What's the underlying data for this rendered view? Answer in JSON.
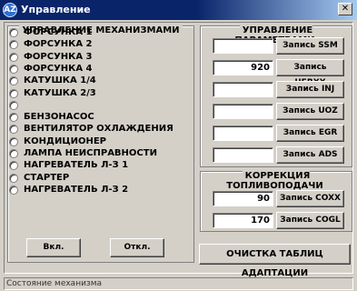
{
  "window": {
    "title": "Управление",
    "icon_text": "AZ",
    "close_symbol": "✕"
  },
  "mechanisms": {
    "title": "УПРАВЛЕНИЕ МЕХАНИЗМАМИ",
    "items": [
      "ФОРСУНКА 1",
      "ФОРСУНКА 2",
      "ФОРСУНКА 3",
      "ФОРСУНКА 4",
      "КАТУШКА 1/4",
      "КАТУШКА 2/3",
      "",
      "БЕНЗОНАСОС",
      "ВЕНТИЛЯТОР ОХЛАЖДЕНИЯ",
      "КОНДИЦИОНЕР",
      "ЛАМПА НЕИСПРАВНОСТИ",
      "НАГРЕВАТЕЛЬ Л-З 1",
      "СТАРТЕР",
      "НАГРЕВАТЕЛЬ Л-З 2"
    ],
    "on_button": "Вкл.",
    "off_button": "Откл."
  },
  "params": {
    "title": "УПРАВЛЕНИЕ ПАРАМЕТРАМИ",
    "rows": [
      {
        "value": "",
        "button": "Запись SSM"
      },
      {
        "value": "920",
        "button": "Запись UFRXX"
      },
      {
        "value": "",
        "button": "Запись INJ"
      },
      {
        "value": "",
        "button": "Запись UOZ"
      },
      {
        "value": "",
        "button": "Запись EGR"
      },
      {
        "value": "",
        "button": "Запись ADS"
      }
    ]
  },
  "fuel": {
    "title": "КОРРЕКЦИЯ ТОПЛИВОПОДАЧИ",
    "rows": [
      {
        "value": "90",
        "button": "Запись COXX"
      },
      {
        "value": "170",
        "button": "Запись COGL"
      }
    ]
  },
  "clear_button": "ОЧИСТКА ТАБЛИЦ АДАПТАЦИИ",
  "status": "Состояние механизма"
}
